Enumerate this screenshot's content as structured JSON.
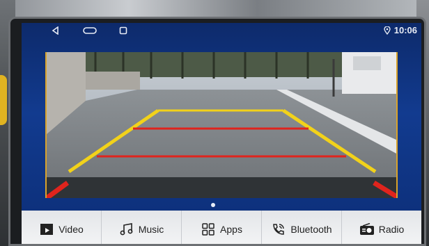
{
  "statusbar": {
    "time": "10:06",
    "location_icon": "location-pin-icon",
    "nav": [
      "back-icon",
      "home-icon",
      "recent-apps-icon"
    ]
  },
  "camera": {
    "description_icon": "rear-camera-view",
    "guide_colors": {
      "near": "#e0241d",
      "mid": "#e0241d",
      "far": "#f2d21a",
      "sides": "#f2d21a"
    }
  },
  "dock": {
    "items": [
      {
        "label": "Video",
        "icon": "video-icon"
      },
      {
        "label": "Music",
        "icon": "music-icon"
      },
      {
        "label": "Apps",
        "icon": "apps-grid-icon"
      },
      {
        "label": "Bluetooth",
        "icon": "bluetooth-phone-icon"
      },
      {
        "label": "Radio",
        "icon": "radio-icon"
      }
    ]
  },
  "colors": {
    "screen_bg": "#123b8f",
    "dock_bg": "#eceef0",
    "accent_frame": "#d9a32b"
  }
}
